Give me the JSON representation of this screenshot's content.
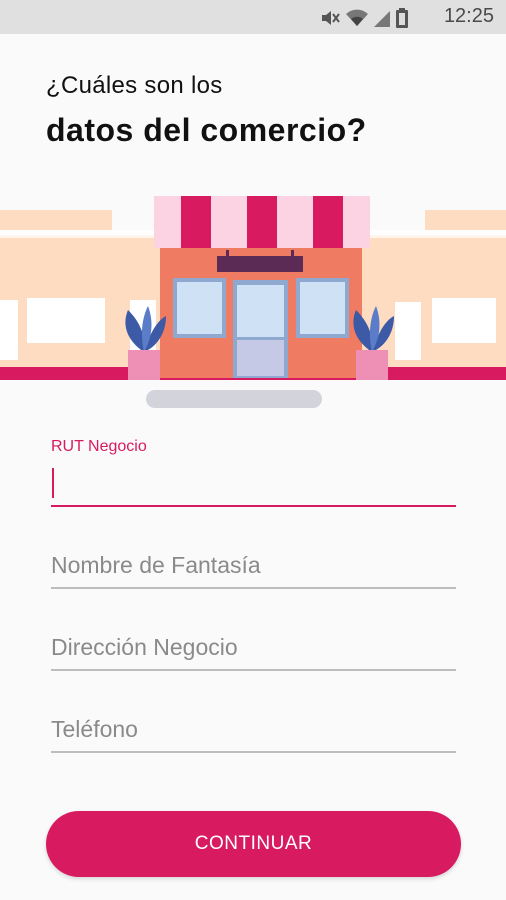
{
  "status_bar": {
    "time": "12:25",
    "icons": [
      "mute-icon",
      "wifi-icon",
      "signal-icon",
      "battery-icon"
    ]
  },
  "heading": {
    "line1": "¿Cuáles son los",
    "line2": "datos del comercio?"
  },
  "form": {
    "rut": {
      "label": "RUT Negocio",
      "value": ""
    },
    "nombre": {
      "placeholder": "Nombre de Fantasía",
      "value": ""
    },
    "direccion": {
      "placeholder": "Dirección Negocio",
      "value": ""
    },
    "telefono": {
      "placeholder": "Teléfono",
      "value": ""
    }
  },
  "continue_label": "CONTINUAR",
  "colors": {
    "accent": "#d81b60",
    "background": "#fafafa",
    "store_body": "#ef7b63",
    "awning_stripe_dark": "#d81b60",
    "awning_stripe_light": "#fbd3e3",
    "buildings": "#fddcc1"
  }
}
